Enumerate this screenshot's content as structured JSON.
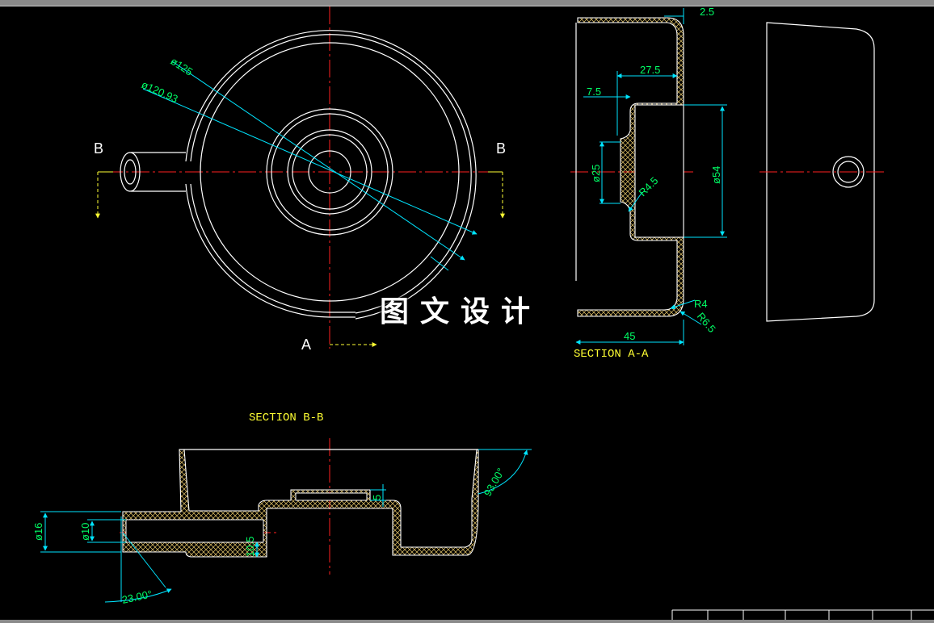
{
  "views": {
    "section_aa": {
      "title": "SECTION A-A"
    },
    "section_bb": {
      "title": "SECTION B-B"
    }
  },
  "cut_labels": {
    "b_left": "B",
    "b_right": "B",
    "a_bottom": "A"
  },
  "dimensions": {
    "dia_125": "ø125",
    "dia_120_93": "ø120.93",
    "d_2_5": "2.5",
    "d_27_5": "27.5",
    "d_7_5": "7.5",
    "dia_25": "ø25",
    "r_4_5": "R4.5",
    "dia_54": "ø54",
    "r_4": "R4",
    "r_6_5": "R6.5",
    "d_45": "45",
    "ang_93": "93.00°",
    "d_5": "5",
    "dia_16": "ø16",
    "dia_10": "ø10",
    "d_10_5": "10.5",
    "ang_23": "23.00°"
  },
  "watermark": "图文设计",
  "colors": {
    "outline": "#ffffff",
    "centerline": "#ff2020",
    "dimension": "#00e5ff",
    "dim_text": "#00ff66",
    "label": "#ffff33",
    "hatch": "#ffe060"
  }
}
